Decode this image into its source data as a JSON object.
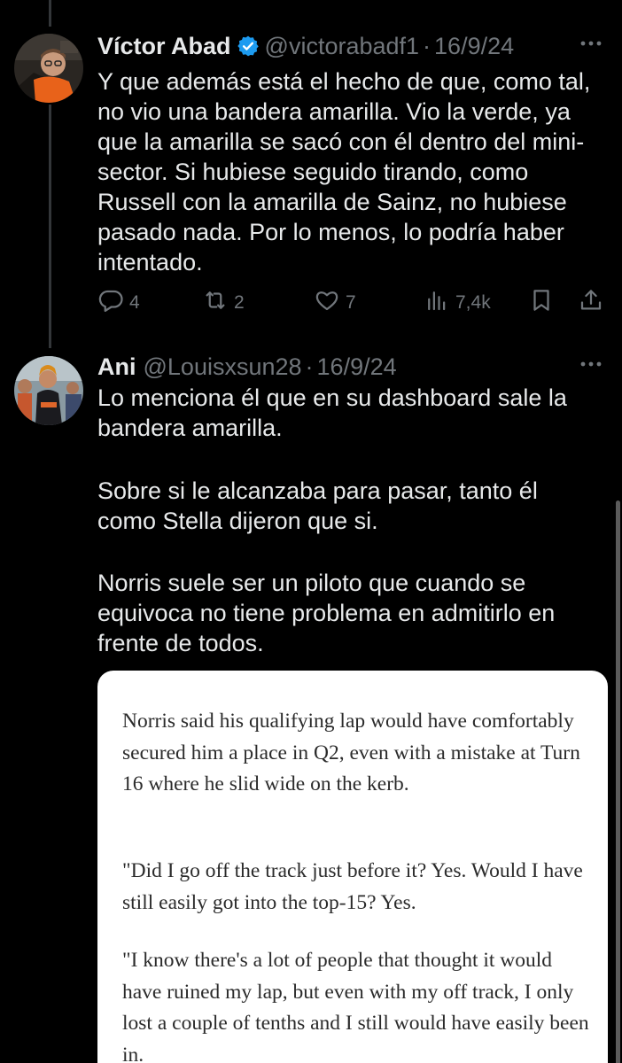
{
  "tweets": [
    {
      "display_name": "Víctor Abad",
      "handle": "@victorabadf1",
      "separator": "·",
      "date": "16/9/24",
      "verified": true,
      "text": "Y que además está el hecho de que, como tal, no vio una bandera amarilla. Vio la verde, ya que la amarilla se sacó con él dentro del mini-sector. Si hubiese seguido tirando, como Russell con la amarilla de Sainz, no hubiese pasado nada. Por lo menos, lo podría haber intentado.",
      "actions": {
        "replies": "4",
        "reposts": "2",
        "likes": "7",
        "views": "7,4k"
      }
    },
    {
      "display_name": "Ani",
      "handle": "@Louisxsun28",
      "separator": "·",
      "date": "16/9/24",
      "verified": false,
      "paragraphs": [
        "Lo menciona él que en su dashboard sale la bandera amarilla.",
        "Sobre si le alcanzaba para pasar, tanto él como Stella dijeron que si.",
        "Norris suele ser un piloto que cuando se equivoca no tiene problema en admitirlo en frente de todos."
      ]
    }
  ],
  "quote_card": {
    "paragraphs": [
      "Norris said his qualifying lap would have comfortably secured him a place in Q2, even with a mistake at Turn 16 where he slid wide on the kerb.",
      "\"Did I go off the track just before it? Yes. Would I have still easily got into the top-15? Yes.",
      "\"I know there's a lot of people that thought it would have ruined my lap, but even with my off track, I only lost a couple of tenths and I still would have easily been in."
    ]
  },
  "icons": {
    "verified": "verified-badge-icon",
    "more": "more-options-icon",
    "reply": "reply-icon",
    "repost": "repost-icon",
    "like": "heart-icon",
    "views": "views-icon",
    "bookmark": "bookmark-icon",
    "share": "share-icon"
  },
  "colors": {
    "background": "#000000",
    "text": "#e7e9ea",
    "muted": "#71767b",
    "verified": "#1d9bf0",
    "card": "#ffffff"
  }
}
